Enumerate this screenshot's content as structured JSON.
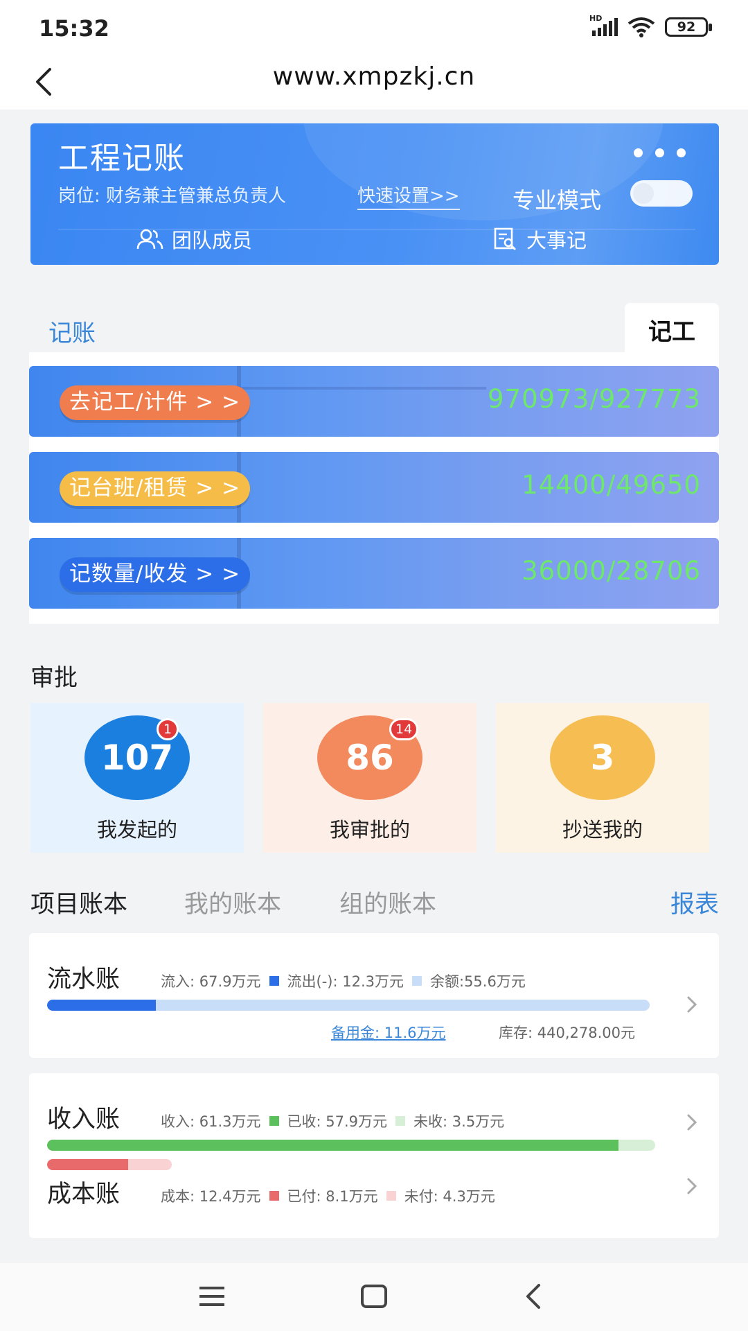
{
  "status": {
    "time": "15:32",
    "signal_label": "HD",
    "battery": "92"
  },
  "nav": {
    "url": "www.xmpzkj.cn"
  },
  "header": {
    "title": "工程记账",
    "role": "岗位: 财务兼主管兼总负责人",
    "quick_setup": "快速设置>>",
    "mode_label": "专业模式",
    "team_label": "团队成员",
    "events_label": "大事记"
  },
  "tabs": {
    "bookkeeping": "记账",
    "work": "记工"
  },
  "records": [
    {
      "label": "去记工/计件 > >",
      "value": "970973/927773"
    },
    {
      "label": "记台班/租赁 > >",
      "value": "14400/49650"
    },
    {
      "label": "记数量/收发 > >",
      "value": "36000/28706"
    }
  ],
  "approval": {
    "title": "审批",
    "items": [
      {
        "count": "107",
        "badge": "1",
        "label": "我发起的"
      },
      {
        "count": "86",
        "badge": "14",
        "label": "我审批的"
      },
      {
        "count": "3",
        "badge": "",
        "label": "抄送我的"
      }
    ]
  },
  "ledger_tabs": {
    "project": "项目账本",
    "mine": "我的账本",
    "group": "组的账本",
    "report": "报表"
  },
  "cash_flow": {
    "name": "流水账",
    "inflow": "流入: 67.9万元",
    "outflow": "流出(-): 12.3万元",
    "balance": "余额:55.6万元",
    "outflow_ratio": 0.18,
    "reserve": "备用金: 11.6万元",
    "stock": "库存: 440,278.00元"
  },
  "income": {
    "name": "收入账",
    "total": "收入: 61.3万元",
    "received": "已收: 57.9万元",
    "pending": "未收: 3.5万元",
    "received_ratio": 0.94
  },
  "cost": {
    "name": "成本账",
    "total": "成本: 12.4万元",
    "paid": "已付: 8.1万元",
    "unpaid": "未付: 4.3万元",
    "paid_ratio": 0.65
  },
  "colors": {
    "accent": "#3a86f2",
    "green": "#5cc05c",
    "red": "#e96a6a",
    "orange": "#f07d4e",
    "yellow": "#f5bd47"
  }
}
